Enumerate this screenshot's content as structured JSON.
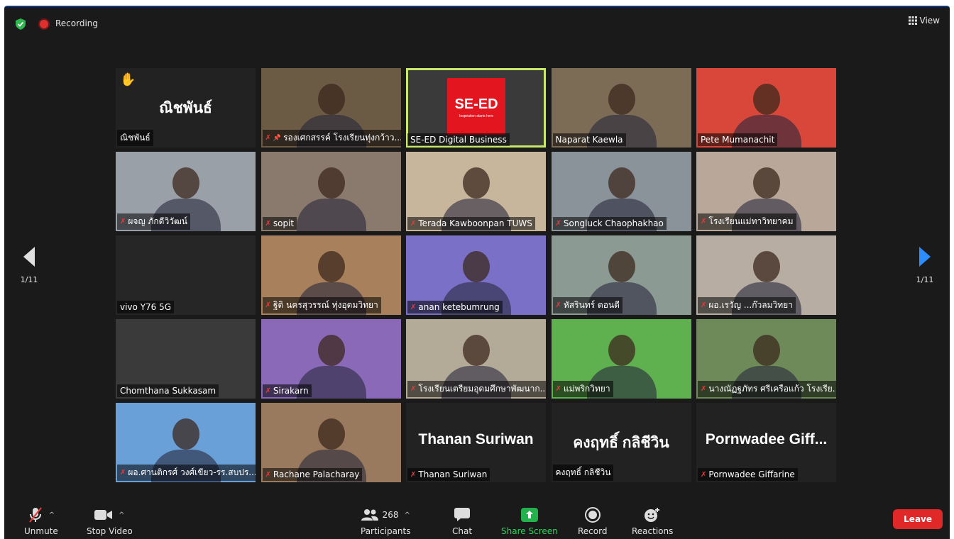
{
  "top": {
    "recording_label": "Recording",
    "view_label": "View"
  },
  "nav": {
    "page_left": "1/11",
    "page_right": "1/11"
  },
  "tiles": [
    {
      "name": "ณิชพันธ์",
      "big": "ณิชพันธ์",
      "hand": "✋",
      "bg": "#222"
    },
    {
      "name": "รองเศกสรรค์ โรงเรียนทุ่งกว้าว...",
      "muted": true,
      "pinned": true,
      "bg": "#6b5a44"
    },
    {
      "name": "SE-ED Digital Business",
      "logo": "SE-ED",
      "logo_sub": "Inspiration starts here",
      "bg": "#3a3a3a",
      "active": true
    },
    {
      "name": "Naparat Kaewla",
      "bg": "#7c6b55"
    },
    {
      "name": "Pete Mumanachit",
      "bg": "#d9473b"
    },
    {
      "name": "ผจญ ภักดีวิวัฒน์",
      "muted": true,
      "bg": "#9aa0a8"
    },
    {
      "name": "sopit",
      "muted": true,
      "bg": "#8a7a6d"
    },
    {
      "name": "Terada Kawboonpan TUWS",
      "muted": true,
      "bg": "#c7b59c"
    },
    {
      "name": "Songluck Chaophakhao",
      "muted": true,
      "bg": "#8a929a"
    },
    {
      "name": "โรงเรียนแม่ทาวิทยาคม",
      "muted": true,
      "bg": "#b9a89a"
    },
    {
      "name": "vivo Y76 5G",
      "bg": "#262626"
    },
    {
      "name": "ฐิติ นครสุวรรณ์ ทุ่งอุดมวิทยา",
      "muted": true,
      "bg": "#a8805c"
    },
    {
      "name": "anan  ketebumrung",
      "muted": true,
      "bg": "#7a70c8"
    },
    {
      "name": "หัสรินทร์ ดอนดี",
      "muted": true,
      "bg": "#8c9a94"
    },
    {
      "name": "ผอ.เรวัญ ...ก๊วลมวิทยา",
      "muted": true,
      "bg": "#b7ada3"
    },
    {
      "name": "Chomthana Sukkasam",
      "bg": "#3a3a3a"
    },
    {
      "name": "Sirakarn",
      "muted": true,
      "bg": "#8a6ab8"
    },
    {
      "name": "โรงเรียนเตรียมอุดมศึกษาพัฒนาก...",
      "muted": true,
      "bg": "#b4aa98"
    },
    {
      "name": "แม่พริกวิทยา",
      "muted": true,
      "bg": "#5fb04f"
    },
    {
      "name": "นางณัฏฐภัทร ศรีเครือแก้ว โรงเรีย...",
      "muted": true,
      "bg": "#6e8a58"
    },
    {
      "name": "ผอ.ศานติกรศ์ วงศ์เขียว-รร.สบปร...",
      "muted": true,
      "bg": "#6aa0d8"
    },
    {
      "name": "Rachane Palacharay",
      "muted": true,
      "bg": "#9a7a5e"
    },
    {
      "name": "Thanan Suriwan",
      "big": "Thanan Suriwan",
      "muted": true,
      "bg": "#222"
    },
    {
      "name": "คงฤทธิ์ กลิชีวิน",
      "big": "คงฤทธิ์ กลิชีวิน",
      "bg": "#222"
    },
    {
      "name": "Pornwadee Giffarine",
      "big": "Pornwadee  Giff...",
      "muted": true,
      "bg": "#222"
    }
  ],
  "toolbar": {
    "unmute": "Unmute",
    "stop_video": "Stop Video",
    "participants": "Participants",
    "participants_count": "268",
    "chat": "Chat",
    "share_screen": "Share Screen",
    "record": "Record",
    "reactions": "Reactions",
    "leave": "Leave"
  }
}
